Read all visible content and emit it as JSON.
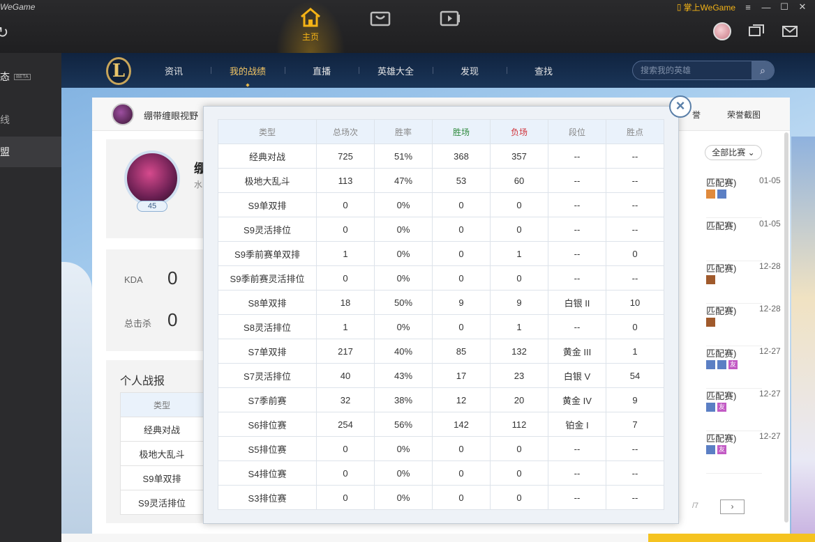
{
  "app": {
    "brand": "WeGame",
    "nav": [
      {
        "label": "主页",
        "icon": "home-icon"
      },
      {
        "label": "",
        "icon": "shop-icon"
      },
      {
        "label": "",
        "icon": "video-icon"
      }
    ],
    "mobile_link": "掌上WeGame"
  },
  "sidebar": {
    "items": [
      {
        "label": "态",
        "badge": "BETA"
      },
      {
        "label": "线"
      },
      {
        "label": "盟"
      }
    ]
  },
  "lol": {
    "logo": "L",
    "nav": [
      "资讯",
      "我的战绩",
      "直播",
      "英雄大全",
      "发现",
      "查找"
    ],
    "active_nav": "我的战绩",
    "search_placeholder": "搜索我的英雄"
  },
  "summary": {
    "name": "绷带缠眼视野",
    "links": [
      "誉",
      "荣誉截图"
    ]
  },
  "profile": {
    "name": "绷",
    "sub": "水",
    "level": "45"
  },
  "stats": {
    "kda_label": "KDA",
    "kda_value": "0",
    "kills_label": "总击杀",
    "kills_value": "0"
  },
  "personal": {
    "title": "个人战报",
    "header": "类型",
    "rows": [
      "经典对战",
      "极地大乱斗",
      "S9单双排",
      "S9灵活排位"
    ]
  },
  "matches": {
    "filter": "全部比赛",
    "items": [
      {
        "title": "匹配赛)",
        "date": "01-05"
      },
      {
        "title": "匹配赛)",
        "date": "01-05"
      },
      {
        "title": "匹配赛)",
        "date": "12-28"
      },
      {
        "title": "匹配赛)",
        "date": "12-28"
      },
      {
        "title": "匹配赛)",
        "date": "12-27"
      },
      {
        "title": "匹配赛)",
        "date": "12-27"
      },
      {
        "title": "匹配赛)",
        "date": "12-27"
      }
    ],
    "pager_total": "/7",
    "friend_tag": "友"
  },
  "modal": {
    "headers": [
      "类型",
      "总场次",
      "胜率",
      "胜场",
      "负场",
      "段位",
      "胜点"
    ],
    "rows": [
      [
        "经典对战",
        "725",
        "51%",
        "368",
        "357",
        "--",
        "--"
      ],
      [
        "极地大乱斗",
        "113",
        "47%",
        "53",
        "60",
        "--",
        "--"
      ],
      [
        "S9单双排",
        "0",
        "0%",
        "0",
        "0",
        "--",
        "--"
      ],
      [
        "S9灵活排位",
        "0",
        "0%",
        "0",
        "0",
        "--",
        "--"
      ],
      [
        "S9季前赛单双排",
        "1",
        "0%",
        "0",
        "1",
        "--",
        "0"
      ],
      [
        "S9季前赛灵活排位",
        "0",
        "0%",
        "0",
        "0",
        "--",
        "--"
      ],
      [
        "S8单双排",
        "18",
        "50%",
        "9",
        "9",
        "白银 II",
        "10"
      ],
      [
        "S8灵活排位",
        "1",
        "0%",
        "0",
        "1",
        "--",
        "0"
      ],
      [
        "S7单双排",
        "217",
        "40%",
        "85",
        "132",
        "黄金 III",
        "1"
      ],
      [
        "S7灵活排位",
        "40",
        "43%",
        "17",
        "23",
        "白银 V",
        "54"
      ],
      [
        "S7季前赛",
        "32",
        "38%",
        "12",
        "20",
        "黄金 IV",
        "9"
      ],
      [
        "S6排位赛",
        "254",
        "56%",
        "142",
        "112",
        "铂金 I",
        "7"
      ],
      [
        "S5排位赛",
        "0",
        "0%",
        "0",
        "0",
        "--",
        "--"
      ],
      [
        "S4排位赛",
        "0",
        "0%",
        "0",
        "0",
        "--",
        "--"
      ],
      [
        "S3排位赛",
        "0",
        "0%",
        "0",
        "0",
        "--",
        "--"
      ]
    ]
  }
}
